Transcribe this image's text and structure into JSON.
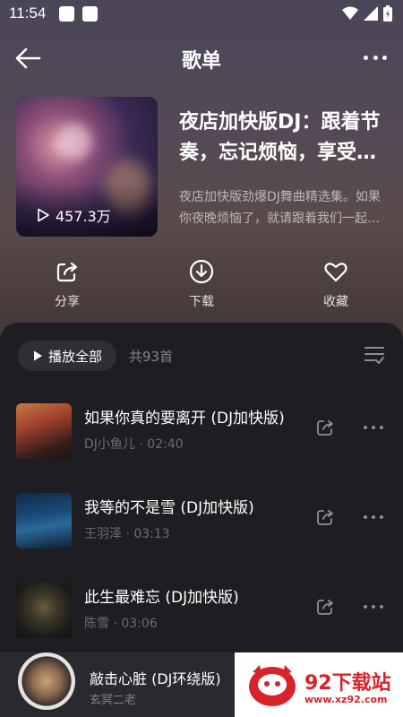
{
  "status_bar": {
    "time": "11:54"
  },
  "header": {
    "title": "歌单"
  },
  "playlist": {
    "title": "夜店加快版DJ：跟着节奏，忘记烦恼，享受快乐",
    "description": "夜店加快版劲爆DJ舞曲精选集。如果你夜晚烦恼了，就请跟着我们一起摇摆吧",
    "play_count": "457.3万"
  },
  "actions": {
    "share": "分享",
    "download": "下载",
    "favorite": "收藏"
  },
  "list": {
    "play_all": "播放全部",
    "count": "共93首",
    "songs": [
      {
        "title": "如果你真的要离开 (DJ加快版)",
        "artist": "DJ小鱼儿",
        "duration": "02:40"
      },
      {
        "title": "我等的不是雪 (DJ加快版)",
        "artist": "王羽泽",
        "duration": "03:13"
      },
      {
        "title": "此生最难忘 (DJ加快版)",
        "artist": "陈雪",
        "duration": "03:06"
      }
    ]
  },
  "mini_player": {
    "title": "敲击心脏 (DJ环绕版)",
    "artist": "玄冥二老"
  },
  "watermark": {
    "name": "92下载站",
    "url": "www.xz92.com"
  },
  "colors": {
    "accent": "#d8232a",
    "panel": "#1e1d22",
    "chip": "#2f2e35"
  }
}
